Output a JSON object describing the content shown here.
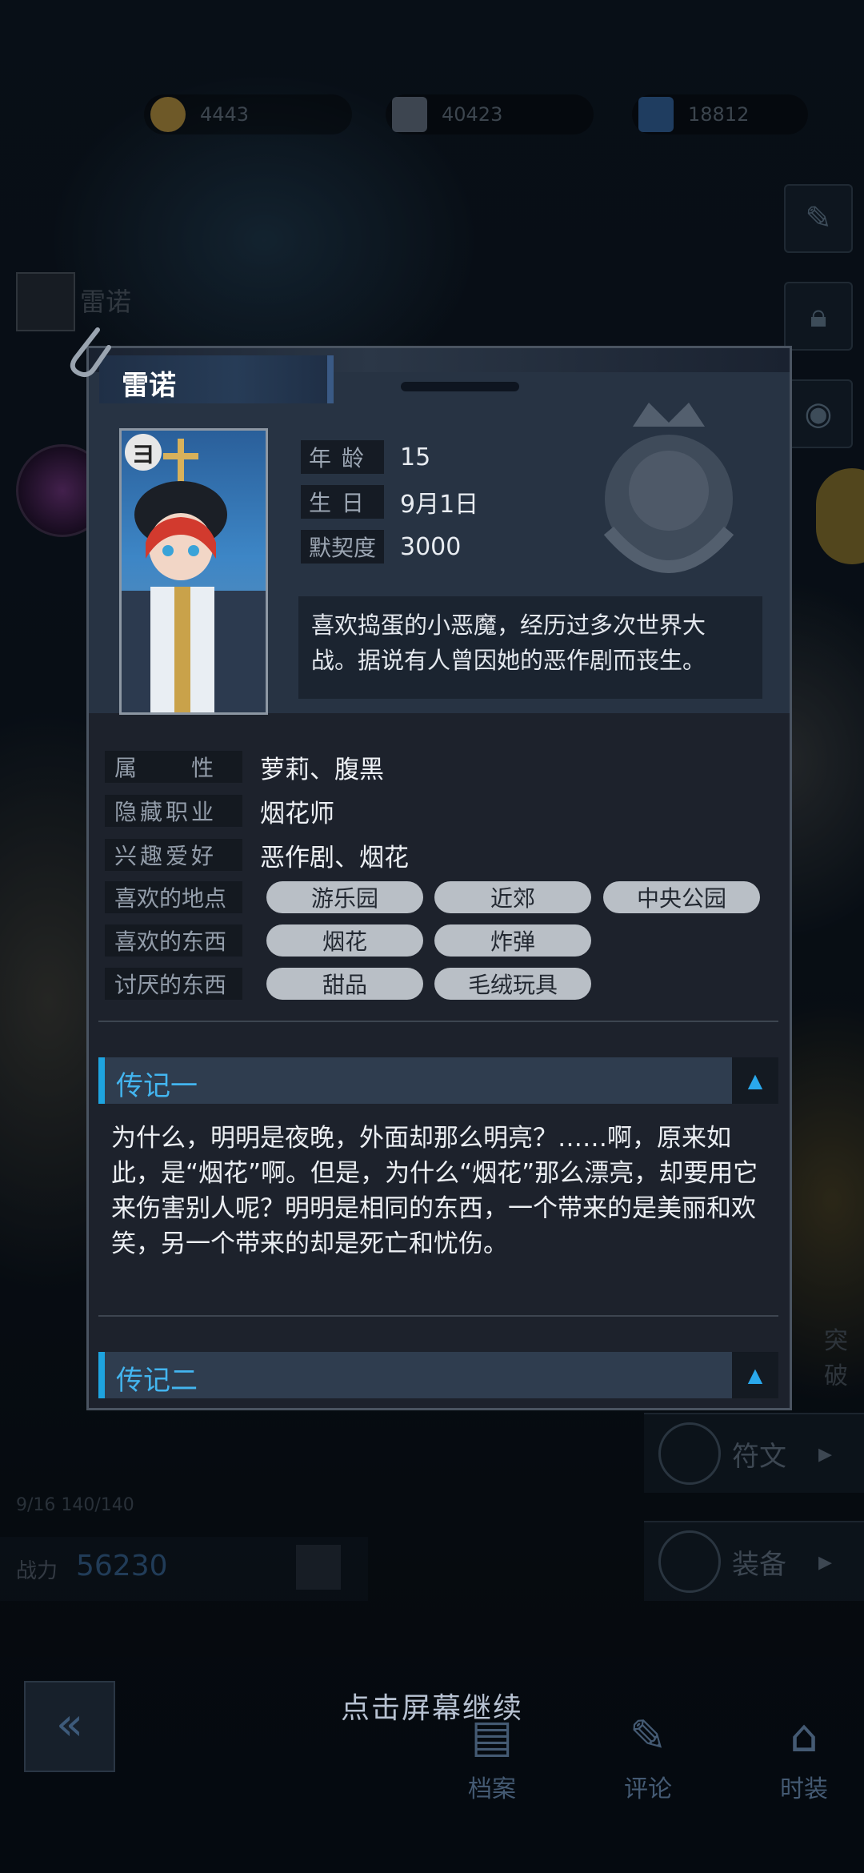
{
  "resources": [
    "4443",
    "40423",
    "18812"
  ],
  "background": {
    "character_label": "雷诺",
    "power_label": "战力",
    "power_value": "56230",
    "menu_runes": "符文",
    "menu_equip": "装备",
    "level_text": "9/16 140/140",
    "side_tag": "突破"
  },
  "bottom": {
    "continue_text": "点击屏幕继续",
    "nav": [
      "档案",
      "评论",
      "时装"
    ]
  },
  "profile": {
    "name": "雷诺",
    "stats": [
      {
        "label": "年 龄",
        "value": "15"
      },
      {
        "label": "生 日",
        "value": "9月1日"
      },
      {
        "label": "默契度",
        "value": "3000"
      }
    ],
    "description": "喜欢捣蛋的小恶魔，经历过多次世界大战。据说有人曾因她的恶作剧而丧生。",
    "traits": [
      {
        "label": "属　　性",
        "value": "萝莉、腹黑"
      },
      {
        "label": "隐藏职业",
        "value": "烟花师"
      },
      {
        "label": "兴趣爱好",
        "value": "恶作剧、烟花"
      }
    ],
    "likes_places_label": "喜欢的地点",
    "likes_places": [
      "游乐园",
      "近郊",
      "中央公园"
    ],
    "likes_things_label": "喜欢的东西",
    "likes_things": [
      "烟花",
      "炸弹"
    ],
    "dislikes_label": "讨厌的东西",
    "dislikes": [
      "甜品",
      "毛绒玩具"
    ]
  },
  "bios": [
    {
      "title": "传记一",
      "text": "为什么，明明是夜晚，外面却那么明亮？……啊，原来如此，是“烟花”啊。但是，为什么“烟花”那么漂亮，却要用它来伤害别人呢？明明是相同的东西，一个带来的是美丽和欢笑，另一个带来的却是死亡和忧伤。"
    },
    {
      "title": "传记二"
    }
  ],
  "colors": {
    "accent": "#1ea4e0",
    "panel": "#1d222c",
    "tag": "#b9bfc6"
  },
  "icons": [
    "coin-icon",
    "ticket-icon",
    "crystal-icon",
    "edit-icon",
    "lock-icon",
    "eye-icon",
    "paperclip-icon",
    "lion-crest-icon",
    "back-icon",
    "rune-gear-icon"
  ]
}
